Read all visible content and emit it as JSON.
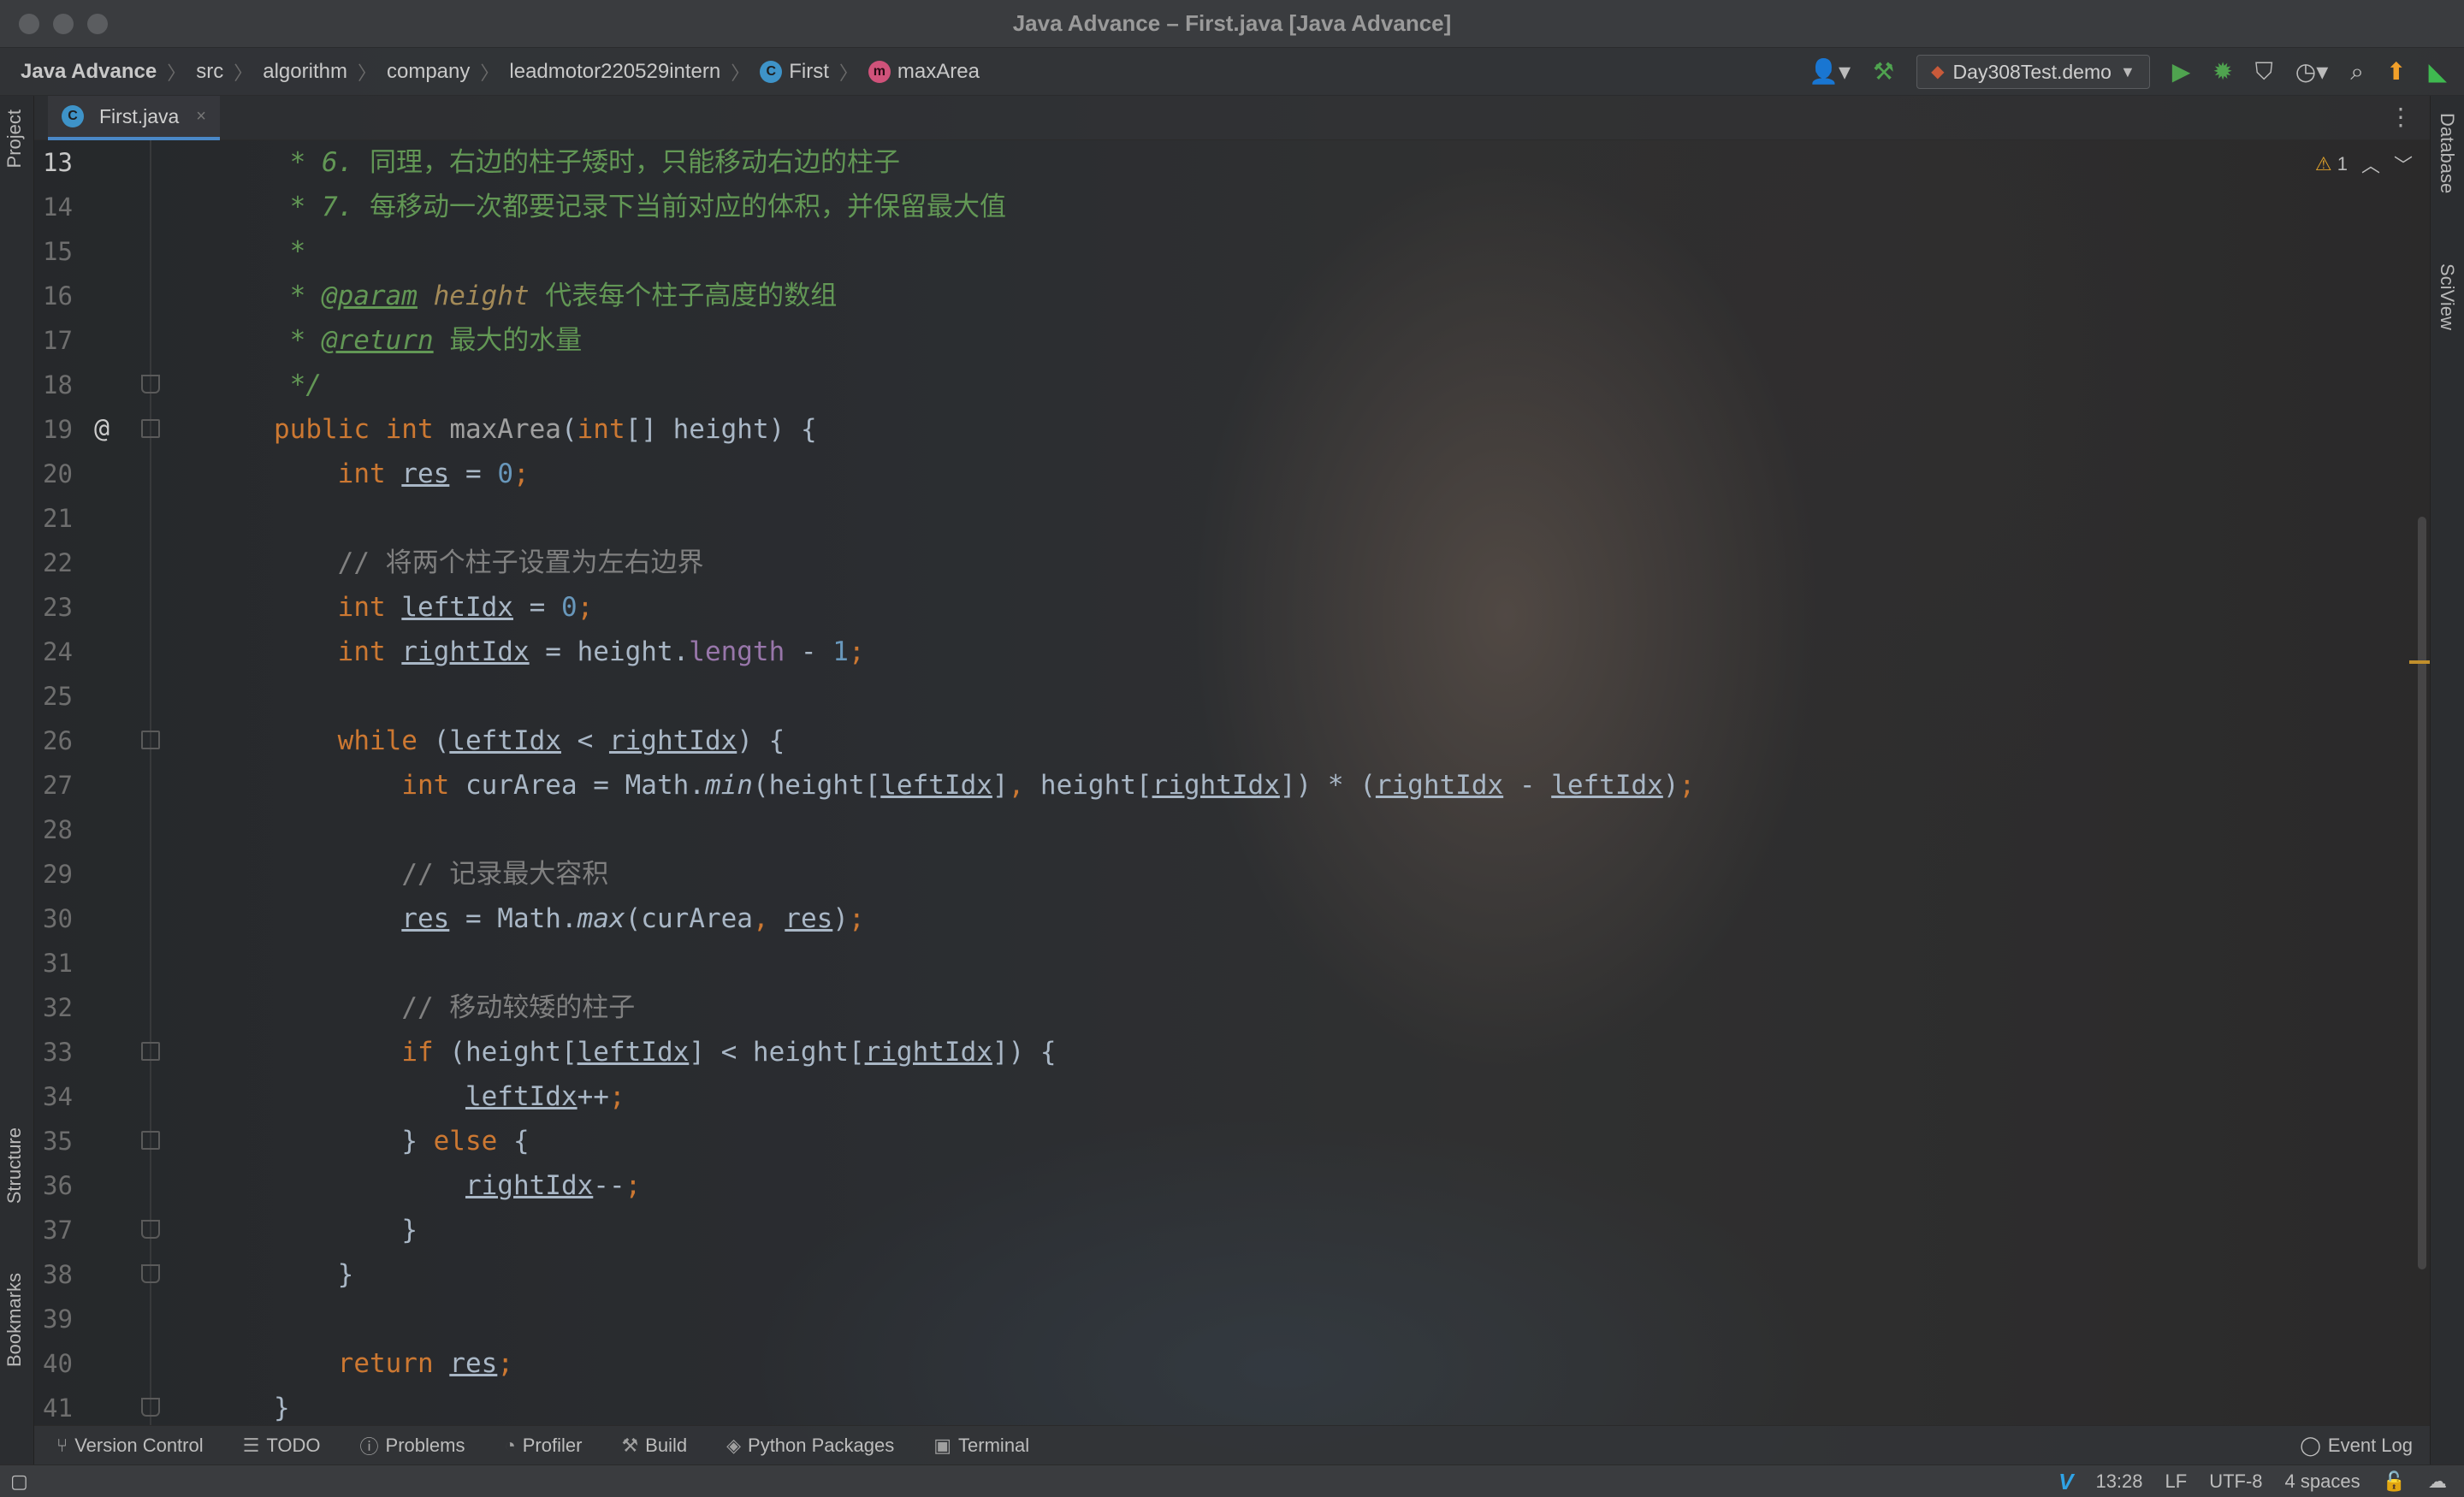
{
  "window": {
    "title": "Java Advance – First.java [Java Advance]"
  },
  "breadcrumbs": [
    "Java Advance",
    "src",
    "algorithm",
    "company",
    "leadmotor220529intern",
    "First",
    "maxArea"
  ],
  "run_config": "Day308Test.demo",
  "left_tools": [
    "Project",
    "Structure",
    "Bookmarks"
  ],
  "right_tools": [
    "Database",
    "SciView"
  ],
  "editor_tab": {
    "label": "First.java"
  },
  "inspection": {
    "warnings": "1"
  },
  "code_lines": [
    {
      "n": "13",
      "cur": true,
      "html": "    <span class=\"cmi\">* 6. </span><span class=\"cm\">同理，右边的柱子矮时，只能移动右边的柱子</span>"
    },
    {
      "n": "14",
      "html": "    <span class=\"cmi\">* 7. </span><span class=\"cm\">每移动一次都要记录下当前对应的体积，并保留最大值</span>"
    },
    {
      "n": "15",
      "html": "    <span class=\"cmi\">*</span>"
    },
    {
      "n": "16",
      "html": "    <span class=\"cmi\">* </span><span class=\"tag\">@param</span> <span class=\"pname\">height</span> <span class=\"cm\">代表每个柱子高度的数组</span>"
    },
    {
      "n": "17",
      "html": "    <span class=\"cmi\">* </span><span class=\"tag\">@return</span> <span class=\"cm\">最大的水量</span>"
    },
    {
      "n": "18",
      "fold": "end",
      "html": "    <span class=\"cmi\">*/</span>"
    },
    {
      "n": "19",
      "at": true,
      "fold": "start",
      "html": "   <span class=\"k\">public int</span> <span class=\"fn\">maxArea</span><span class=\"pl\">(</span><span class=\"k\">int</span><span class=\"pl\">[] height) {</span>"
    },
    {
      "n": "20",
      "html": "       <span class=\"k\">int</span> <span class=\"var\">res</span><span class=\"pl\"> = </span><span class=\"num\">0</span><span class=\"k\">;</span>"
    },
    {
      "n": "21",
      "html": ""
    },
    {
      "n": "22",
      "html": "       <span class=\"lc\">// 将两个柱子设置为左右边界</span>"
    },
    {
      "n": "23",
      "html": "       <span class=\"k\">int</span> <span class=\"var\">leftIdx</span><span class=\"pl\"> = </span><span class=\"num\">0</span><span class=\"k\">;</span>"
    },
    {
      "n": "24",
      "html": "       <span class=\"k\">int</span> <span class=\"var\">rightIdx</span><span class=\"pl\"> = height.</span><span class=\"fld\">length</span><span class=\"pl\"> - </span><span class=\"num\">1</span><span class=\"k\">;</span>"
    },
    {
      "n": "25",
      "html": ""
    },
    {
      "n": "26",
      "fold": "start",
      "html": "       <span class=\"k\">while</span><span class=\"pl\"> (</span><span class=\"var\">leftIdx</span><span class=\"pl\"> &lt; </span><span class=\"var\">rightIdx</span><span class=\"pl\">) {</span>"
    },
    {
      "n": "27",
      "html": "           <span class=\"k\">int</span><span class=\"pl\"> curArea = Math.</span><span class=\"pl it\">min</span><span class=\"pl\">(height[</span><span class=\"var\">leftIdx</span><span class=\"pl\">]</span><span class=\"k\">,</span><span class=\"pl\"> height[</span><span class=\"var\">rightIdx</span><span class=\"pl\">]) * (</span><span class=\"var\">rightIdx</span><span class=\"pl\"> - </span><span class=\"var\">leftIdx</span><span class=\"pl\">)</span><span class=\"k\">;</span>"
    },
    {
      "n": "28",
      "html": ""
    },
    {
      "n": "29",
      "html": "           <span class=\"lc\">// 记录最大容积</span>"
    },
    {
      "n": "30",
      "html": "           <span class=\"var\">res</span><span class=\"pl\"> = Math.</span><span class=\"pl it\">max</span><span class=\"pl\">(curArea</span><span class=\"k\">,</span> <span class=\"var\">res</span><span class=\"pl\">)</span><span class=\"k\">;</span>"
    },
    {
      "n": "31",
      "html": ""
    },
    {
      "n": "32",
      "html": "           <span class=\"lc\">// 移动较矮的柱子</span>"
    },
    {
      "n": "33",
      "fold": "start",
      "html": "           <span class=\"k\">if</span><span class=\"pl\"> (height[</span><span class=\"var\">leftIdx</span><span class=\"pl\">] &lt; height[</span><span class=\"var\">rightIdx</span><span class=\"pl\">]) {</span>"
    },
    {
      "n": "34",
      "html": "               <span class=\"var\">leftIdx</span><span class=\"pl\">++</span><span class=\"k\">;</span>"
    },
    {
      "n": "35",
      "fold": "start",
      "html": "           <span class=\"pl\">} </span><span class=\"k\">else</span><span class=\"pl\"> {</span>"
    },
    {
      "n": "36",
      "html": "               <span class=\"var\">rightIdx</span><span class=\"pl\">--</span><span class=\"k\">;</span>"
    },
    {
      "n": "37",
      "fold": "end",
      "html": "           <span class=\"pl\">}</span>"
    },
    {
      "n": "38",
      "fold": "end",
      "html": "       <span class=\"pl\">}</span>"
    },
    {
      "n": "39",
      "html": ""
    },
    {
      "n": "40",
      "html": "       <span class=\"k\">return</span> <span class=\"var\">res</span><span class=\"k\">;</span>"
    },
    {
      "n": "41",
      "fold": "end",
      "html": "   <span class=\"pl\">}</span>"
    }
  ],
  "tool_windows": [
    "Version Control",
    "TODO",
    "Problems",
    "Profiler",
    "Build",
    "Python Packages",
    "Terminal"
  ],
  "event_log": "Event Log",
  "status": {
    "position": "13:28",
    "line_sep": "LF",
    "encoding": "UTF-8",
    "indent": "4 spaces"
  },
  "colors": {
    "keyword": "#cc7832",
    "comment": "#629755",
    "line_comment": "#808080",
    "number": "#6897bb",
    "field": "#9876aa",
    "accent": "#4a88c7"
  }
}
